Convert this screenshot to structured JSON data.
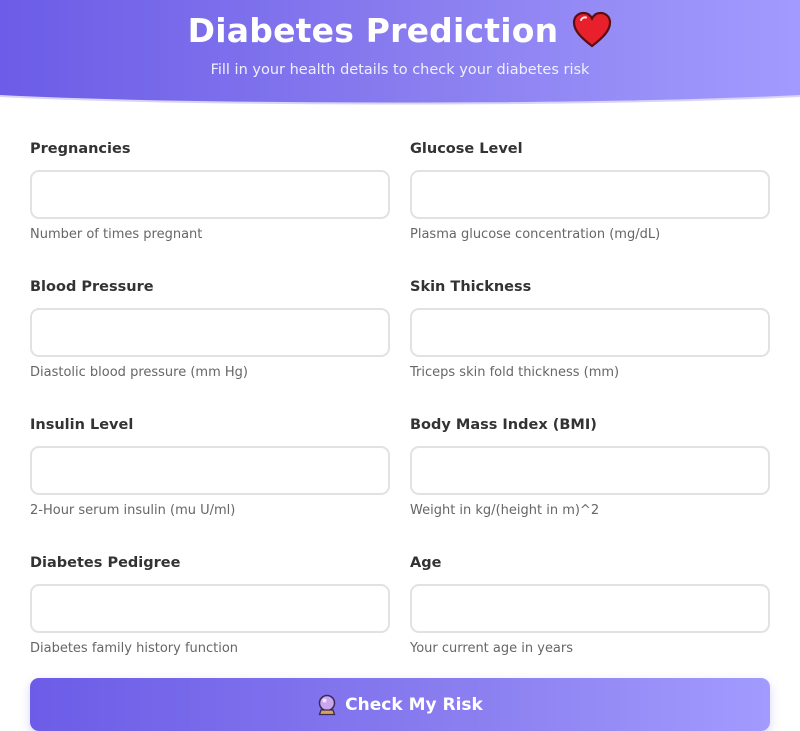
{
  "header": {
    "title": "Diabetes Prediction",
    "subtitle": "Fill in your health details to check your diabetes risk",
    "title_icon": "heart-icon"
  },
  "fields": [
    {
      "label": "Pregnancies",
      "help": "Number of times pregnant",
      "value": ""
    },
    {
      "label": "Glucose Level",
      "help": "Plasma glucose concentration (mg/dL)",
      "value": ""
    },
    {
      "label": "Blood Pressure",
      "help": "Diastolic blood pressure (mm Hg)",
      "value": ""
    },
    {
      "label": "Skin Thickness",
      "help": "Triceps skin fold thickness (mm)",
      "value": ""
    },
    {
      "label": "Insulin Level",
      "help": "2-Hour serum insulin (mu U/ml)",
      "value": ""
    },
    {
      "label": "Body Mass Index (BMI)",
      "help": "Weight in kg/(height in m)^2",
      "value": ""
    },
    {
      "label": "Diabetes Pedigree",
      "help": "Diabetes family history function",
      "value": ""
    },
    {
      "label": "Age",
      "help": "Your current age in years",
      "value": ""
    }
  ],
  "submit": {
    "label": "Check My Risk",
    "icon": "crystal-ball-icon"
  },
  "colors": {
    "accent_start": "#6c5ce7",
    "accent_end": "#a29bfe",
    "heart": "#e8202c"
  }
}
